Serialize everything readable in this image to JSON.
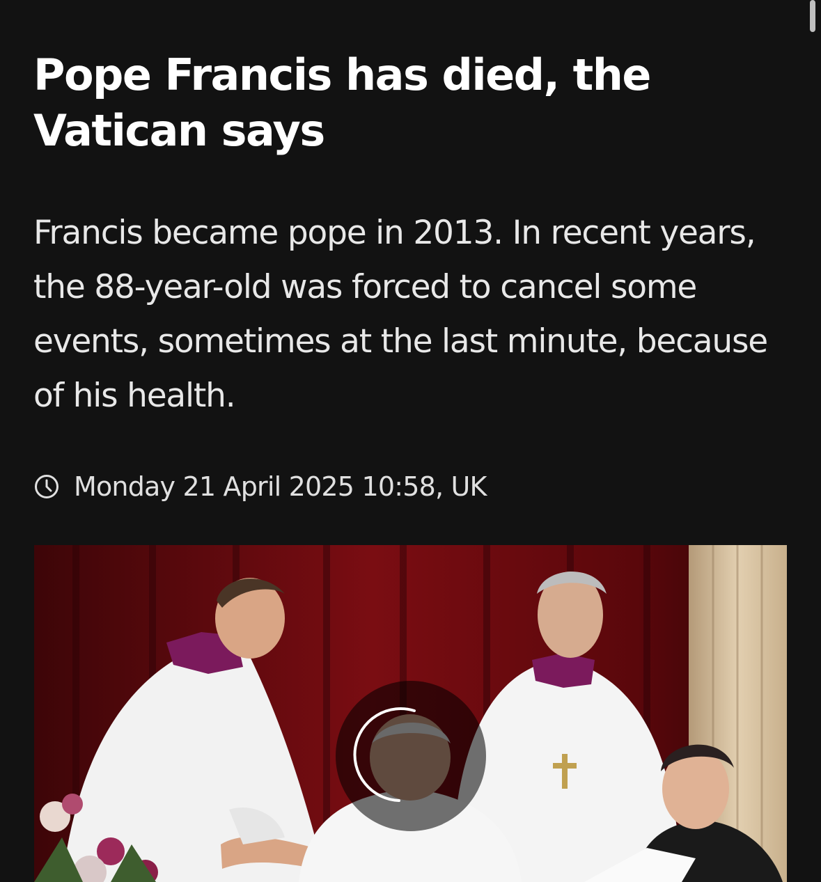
{
  "article": {
    "headline": "Pope Francis has died, the Vatican says",
    "standfirst": "Francis became pope in 2013. In recent years, the 88-year-old was forced to cancel some events, sometimes at the last minute, because of his health.",
    "timestamp": "Monday 21 April 2025 10:58, UK",
    "timestamp_icon": "clock-icon"
  },
  "hero_media": {
    "loading_icon": "loading-spinner-icon"
  },
  "colors": {
    "background": "#121212",
    "text": "#ffffff",
    "curtain": "#6e0a0f"
  }
}
